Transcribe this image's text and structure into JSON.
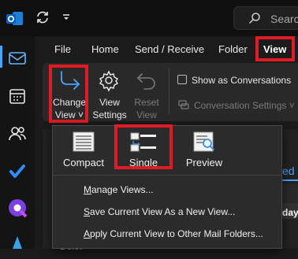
{
  "search": {
    "text": "Searc"
  },
  "tabs": [
    {
      "label": "File"
    },
    {
      "label": "Home"
    },
    {
      "label": "Send / Receive"
    },
    {
      "label": "Folder"
    },
    {
      "label": "View"
    }
  ],
  "ribbon": {
    "change_view": {
      "line1": "Change",
      "line2": "View ˅"
    },
    "view_settings": {
      "line1": "View",
      "line2": "Settings"
    },
    "reset_view": {
      "line1": "Reset",
      "line2": "View"
    },
    "show_as_conversations": "Show as Conversations",
    "conversation_settings": "Conversation Settings ˅"
  },
  "dropdown": {
    "views": [
      {
        "label": "Compact"
      },
      {
        "label": "Single"
      },
      {
        "label": "Preview"
      }
    ],
    "menu": [
      {
        "label": "Manage Views...",
        "accel": "M",
        "rest": "anage Views..."
      },
      {
        "label": "Save Current View As a New View...",
        "accel": "S",
        "rest": "ave Current View As a New View..."
      },
      {
        "label": "Apply Current View to Other Mail Folders...",
        "accel": "A",
        "rest": "pply Current View to Other Mail Folders..."
      }
    ]
  },
  "background": {
    "pane_tab_fragment": "ed",
    "day_fragment": "day",
    "row_fragment": "Delet"
  },
  "colors": {
    "highlight": "#e01b24",
    "accent": "#4aa3ff"
  }
}
